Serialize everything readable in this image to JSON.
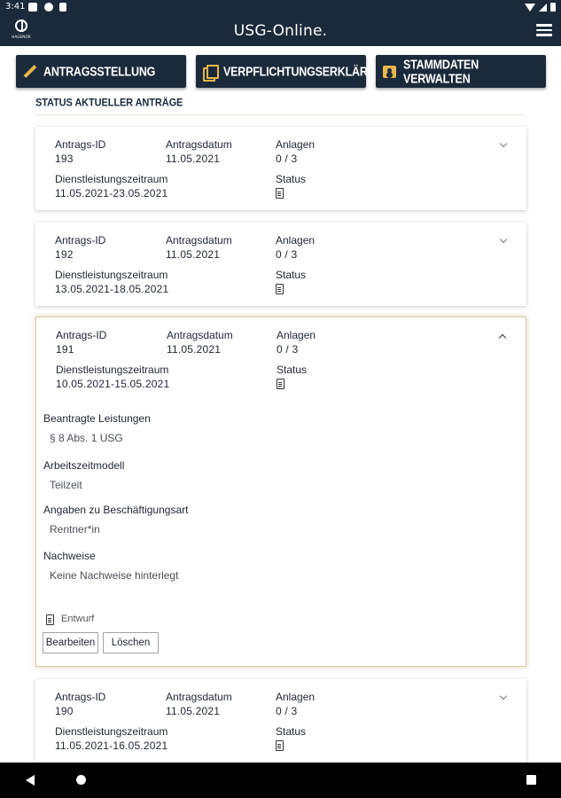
{
  "status_bar": {
    "time": "3:41"
  },
  "app": {
    "logo_text": "HAGENOR",
    "title": "USG-Online."
  },
  "actions": {
    "antragsstellung": "Antragsstellung",
    "verpflichtung": "Verpflichtungserklärung",
    "stammdaten": "Stammdaten verwalten"
  },
  "section": {
    "heading": "Status aktueller Anträge"
  },
  "labels": {
    "antrags_id": "Antrags-ID",
    "antragsdatum": "Antragsdatum",
    "anlagen": "Anlagen",
    "zeitraum": "Dienstleistungszeitraum",
    "status": "Status"
  },
  "cards": [
    {
      "id": "193",
      "datum": "11.05.2021",
      "anlagen": "0 / 3",
      "zeitraum": "11.05.2021-23.05.2021",
      "expanded": false
    },
    {
      "id": "192",
      "datum": "11.05.2021",
      "anlagen": "0 / 3",
      "zeitraum": "13.05.2021-18.05.2021",
      "expanded": false
    },
    {
      "id": "191",
      "datum": "11.05.2021",
      "anlagen": "0 / 3",
      "zeitraum": "10.05.2021-15.05.2021",
      "expanded": true
    },
    {
      "id": "190",
      "datum": "11.05.2021",
      "anlagen": "0 / 3",
      "zeitraum": "11.05.2021-16.05.2021",
      "expanded": false
    }
  ],
  "details": {
    "leistungen_label": "Beantragte Leistungen",
    "leistungen_value": "§ 8 Abs. 1 USG",
    "arbeitszeit_label": "Arbeitszeitmodell",
    "arbeitszeit_value": "Teilzeit",
    "beschaeftigung_label": "Angaben zu Beschäftigungsart",
    "beschaeftigung_value": "Rentner*in",
    "nachweise_label": "Nachweise",
    "nachweise_value": "Keine Nachweise hinterlegt",
    "status_text": "Entwurf",
    "edit_label": "Bearbeiten",
    "delete_label": "Löschen"
  }
}
